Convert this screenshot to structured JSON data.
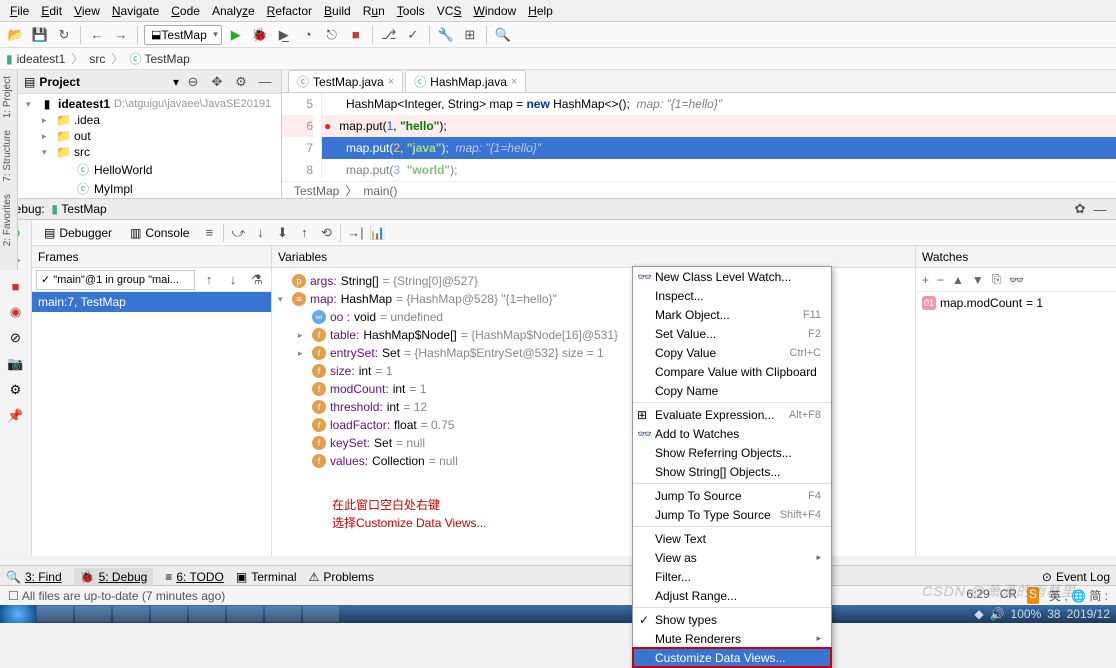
{
  "menu": [
    "File",
    "Edit",
    "View",
    "Navigate",
    "Code",
    "Analyze",
    "Refactor",
    "Build",
    "Run",
    "Tools",
    "VCS",
    "Window",
    "Help"
  ],
  "run_config": "TestMap",
  "breadcrumbs": [
    "ideatest1",
    "src",
    "TestMap"
  ],
  "project": {
    "title": "Project",
    "root": "ideatest1",
    "root_path": "D:\\atguigu\\javaee\\JavaSE20191",
    "folders": [
      ".idea",
      "out",
      "src"
    ],
    "files": [
      "HelloWorld",
      "MyImpl"
    ]
  },
  "editor_tabs": [
    "TestMap.java",
    "HashMap.java"
  ],
  "code": {
    "line5": {
      "n": "5",
      "pre": "HashMap<Integer, String> map = ",
      "kw": "new",
      "rest": " HashMap<>();",
      "cmt": "  map: \"{1=hello}\""
    },
    "line6": {
      "n": "6",
      "txt": "map.put(",
      "num": "1",
      "str": "\"hello\"",
      "end": ");"
    },
    "line7": {
      "n": "7",
      "txt": "map.put(",
      "num": "2",
      "str": "\"java\"",
      "end": ");",
      "cmt": "  map: \"{1=hello}\""
    },
    "line8": {
      "n": "8",
      "txt": "map.put(",
      "num": "3",
      "str": "\"world\"",
      "end": ");"
    }
  },
  "crumb2": [
    "TestMap",
    "main()"
  ],
  "debug_label": "Debug:",
  "debug_config": "TestMap",
  "debug_tabs": {
    "debugger": "Debugger",
    "console": "Console"
  },
  "frames": {
    "title": "Frames",
    "thread": "✓ \"main\"@1 in group \"mai...",
    "frame": "main:7, TestMap"
  },
  "variables": {
    "title": "Variables",
    "args": {
      "label": "args:",
      "type": "String[]",
      "val": "= {String[0]@527}"
    },
    "map": {
      "label": "map:",
      "type": "HashMap",
      "val": "= {HashMap@528} \"{1=hello}\""
    },
    "oo": {
      "label": "oo :",
      "type": "void",
      "val": "= undefined"
    },
    "table": {
      "label": "table:",
      "type": "HashMap$Node[]",
      "val": "= {HashMap$Node[16]@531}"
    },
    "entrySet": {
      "label": "entrySet:",
      "type": "Set",
      "val": "= {HashMap$EntrySet@532}  size = 1"
    },
    "size": {
      "label": "size:",
      "type": "int",
      "val": "= 1"
    },
    "modCount": {
      "label": "modCount:",
      "type": "int",
      "val": "= 1"
    },
    "threshold": {
      "label": "threshold:",
      "type": "int",
      "val": "= 12"
    },
    "loadFactor": {
      "label": "loadFactor:",
      "type": "float",
      "val": "= 0.75"
    },
    "keySet": {
      "label": "keySet:",
      "type": "Set",
      "val": "= null"
    },
    "values": {
      "label": "values:",
      "type": "Collection",
      "val": "= null"
    }
  },
  "annotation": {
    "l1": "在此窗口空白处右键",
    "l2": "选择Customize Data Views..."
  },
  "watches": {
    "title": "Watches",
    "item": "map.modCount",
    "val": "= 1"
  },
  "context_menu": {
    "new_watch": "New Class Level Watch...",
    "inspect": "Inspect...",
    "mark": "Mark Object...",
    "mark_sc": "F11",
    "setval": "Set Value...",
    "setval_sc": "F2",
    "copyval": "Copy Value",
    "copyval_sc": "Ctrl+C",
    "compare": "Compare Value with Clipboard",
    "copyname": "Copy Name",
    "eval": "Evaluate Expression...",
    "eval_sc": "Alt+F8",
    "addwatch": "Add to Watches",
    "showref": "Show Referring Objects...",
    "showstr": "Show String[] Objects...",
    "jmpsrc": "Jump To Source",
    "jmpsrc_sc": "F4",
    "jmptype": "Jump To Type Source",
    "jmptype_sc": "Shift+F4",
    "viewtext": "View Text",
    "viewas": "View as",
    "filter": "Filter...",
    "adjust": "Adjust Range...",
    "showtypes": "Show types",
    "mute": "Mute Renderers",
    "customize": "Customize Data Views..."
  },
  "bottom_tabs": {
    "find": "3: Find",
    "debug": "5: Debug",
    "todo": "6: TODO",
    "terminal": "Terminal",
    "problems": "Problems",
    "eventlog": "Event Log"
  },
  "statusbar": {
    "msg": "All files are up-to-date (7 minutes ago)",
    "pos": "6:29",
    "enc": "CR",
    "ime": "英 , 🌐 简 :"
  },
  "watermark": "CSDN @萧潇的雨幕里",
  "tray_time": "38",
  "tray_date": "2019/12",
  "zoom": "100%"
}
